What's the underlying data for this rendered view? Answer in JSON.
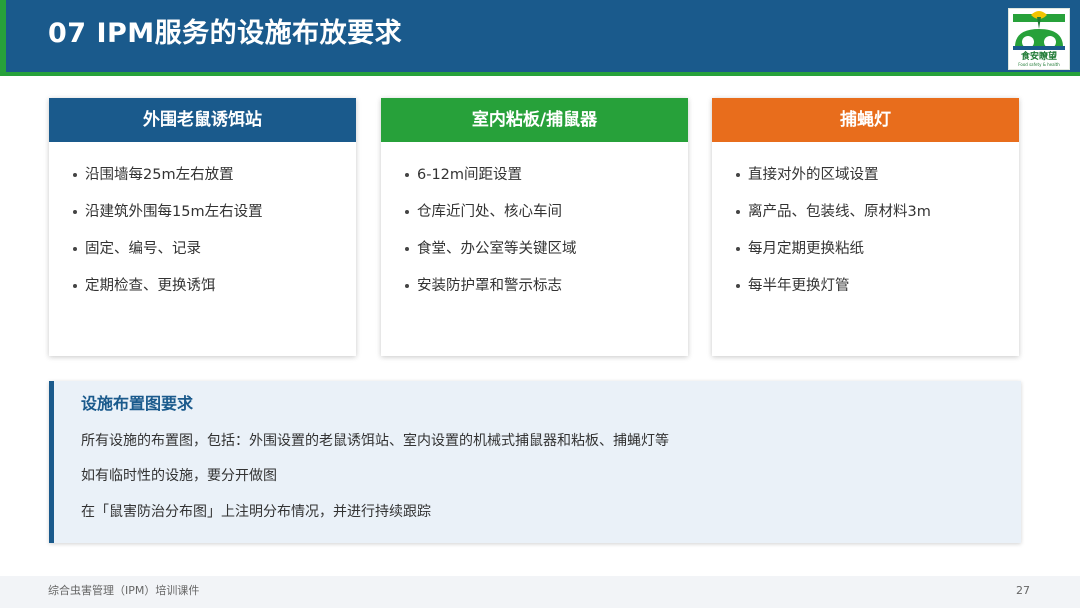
{
  "header": {
    "title": "07  IPM服务的设施布放要求",
    "logo": {
      "name": "食安瞭望",
      "subtitle": "Food safety & health",
      "icon": "cloche-leaf-icon"
    }
  },
  "colors": {
    "primary_blue": "#1a5a8c",
    "green": "#27a13a",
    "orange": "#e86d1c",
    "info_bg": "#eaf1f8"
  },
  "cards": [
    {
      "title": "外围老鼠诱饵站",
      "color": "#1a5a8c",
      "items": [
        "沿围墙每25m左右放置",
        "沿建筑外围每15m左右设置",
        "固定、编号、记录",
        "定期检查、更换诱饵"
      ]
    },
    {
      "title": "室内粘板/捕鼠器",
      "color": "#27a13a",
      "items": [
        "6-12m间距设置",
        "仓库近门处、核心车间",
        "食堂、办公室等关键区域",
        "安装防护罩和警示标志"
      ]
    },
    {
      "title": "捕蝇灯",
      "color": "#e86d1c",
      "items": [
        "直接对外的区域设置",
        "离产品、包装线、原材料3m",
        "每月定期更换粘纸",
        "每半年更换灯管"
      ]
    }
  ],
  "info": {
    "title": "设施布置图要求",
    "lines": [
      "所有设施的布置图，包括：外围设置的老鼠诱饵站、室内设置的机械式捕鼠器和粘板、捕蝇灯等",
      "如有临时性的设施，要分开做图",
      "在「鼠害防治分布图」上注明分布情况，并进行持续跟踪"
    ]
  },
  "footer": {
    "text": "综合虫害管理（IPM）培训课件",
    "page": "27"
  }
}
